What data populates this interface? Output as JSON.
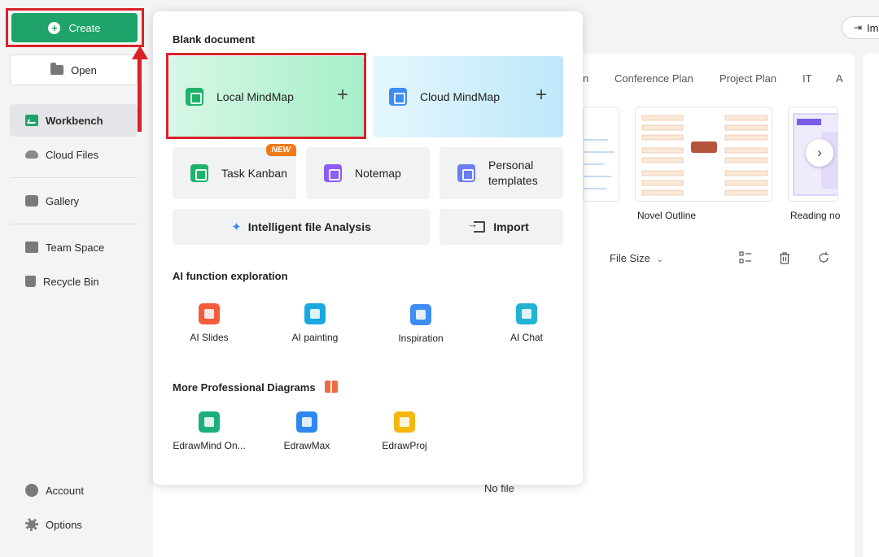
{
  "sidebar": {
    "create_label": "Create",
    "open_label": "Open",
    "items": [
      {
        "label": "Workbench"
      },
      {
        "label": "Cloud Files"
      },
      {
        "label": "Gallery"
      },
      {
        "label": "Team Space"
      },
      {
        "label": "Recycle Bin"
      }
    ],
    "bottom": [
      {
        "label": "Account"
      },
      {
        "label": "Options"
      }
    ]
  },
  "background": {
    "import_top_label": "Im",
    "template_tabs": [
      "n",
      "Conference Plan",
      "Project Plan",
      "IT",
      "A"
    ],
    "template_captions": [
      "Novel Outline",
      "Reading no"
    ],
    "file_size_label": "File Size",
    "no_file_label": "No file"
  },
  "popup": {
    "blank_title": "Blank document",
    "local_mindmap": "Local MindMap",
    "cloud_mindmap": "Cloud MindMap",
    "task_kanban": "Task Kanban",
    "new_badge": "NEW",
    "notemap": "Notemap",
    "personal_templates_line1": "Personal",
    "personal_templates_line2": "templates",
    "intelligent_analysis": "Intelligent file Analysis",
    "import_label": "Import",
    "ai_title": "AI function exploration",
    "ai_items": [
      "AI Slides",
      "AI painting",
      "Inspiration",
      "AI Chat"
    ],
    "more_title": "More Professional Diagrams",
    "more_items": [
      "EdrawMind On...",
      "EdrawMax",
      "EdrawProj"
    ]
  },
  "colors": {
    "accent_green": "#1fa36a",
    "annotation_red": "#d9222a",
    "new_badge_orange": "#f07a1a"
  }
}
